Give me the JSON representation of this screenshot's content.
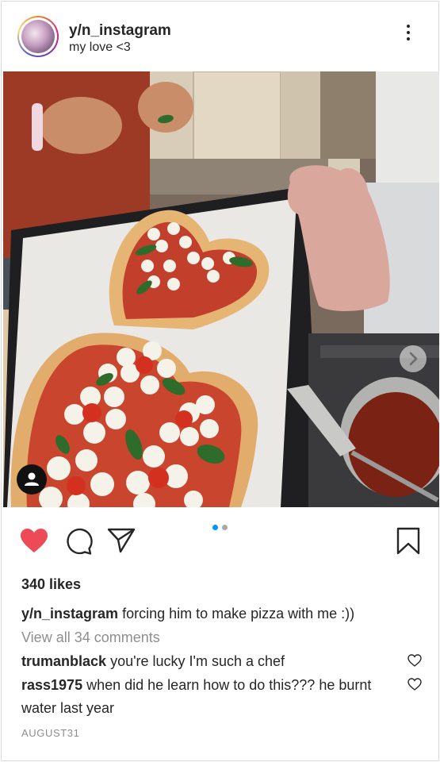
{
  "post": {
    "username": "y/n_instagram",
    "subtitle": "my love <3",
    "likes": "340 likes",
    "caption": {
      "user": "y/n_instagram",
      "text": "forcing him to make pizza with me :))"
    },
    "view_comments": "View all 34 comments",
    "comments": [
      {
        "user": "trumanblack",
        "text": "you're lucky I'm such a chef"
      },
      {
        "user": "rass1975",
        "text": "when did he learn how to do this??? he burnt water last year"
      }
    ],
    "date": "AUGUST31"
  },
  "carousel": {
    "count": 2,
    "active_index": 0
  },
  "icons": {
    "like": "heart-filled-icon",
    "comment": "comment-bubble-icon",
    "share": "paper-plane-icon",
    "save": "bookmark-icon",
    "more": "more-dots-icon",
    "next": "chevron-right-icon",
    "tag": "user-tag-icon"
  },
  "colors": {
    "like": "#ed4956",
    "carousel_active": "#0095f6",
    "carousel_inactive": "#a8a8a8",
    "muted": "#8e8e8e",
    "text": "#262626"
  }
}
